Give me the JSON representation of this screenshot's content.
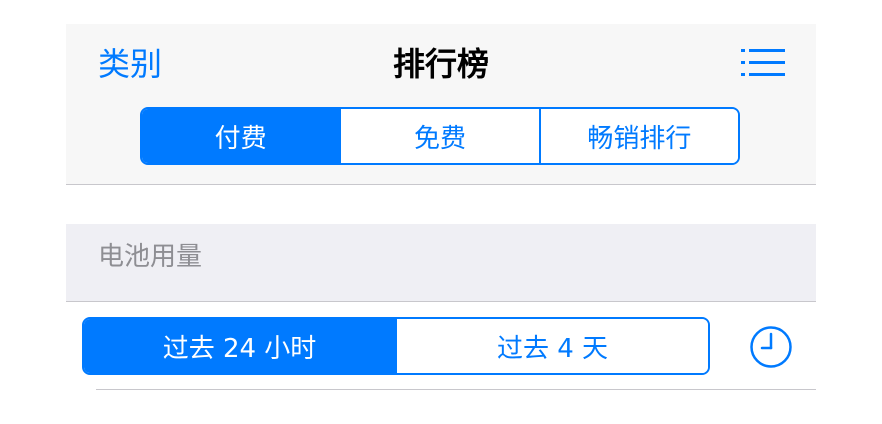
{
  "nav": {
    "left_label": "类别",
    "title": "排行榜",
    "right_icon": "list-icon"
  },
  "top_segments": {
    "items": [
      {
        "label": "付费",
        "selected": true
      },
      {
        "label": "免费",
        "selected": false
      },
      {
        "label": "畅销排行",
        "selected": false
      }
    ]
  },
  "battery_section": {
    "header": "电池用量",
    "segments": [
      {
        "label": "过去 24 小时",
        "selected": true
      },
      {
        "label": "过去 4 天",
        "selected": false
      }
    ],
    "right_icon": "clock-icon"
  },
  "colors": {
    "accent": "#007aff",
    "nav_background": "#f7f7f7",
    "section_background": "#efeff4",
    "separator": "#c8c7cc",
    "secondary_text": "#8e8e93"
  }
}
